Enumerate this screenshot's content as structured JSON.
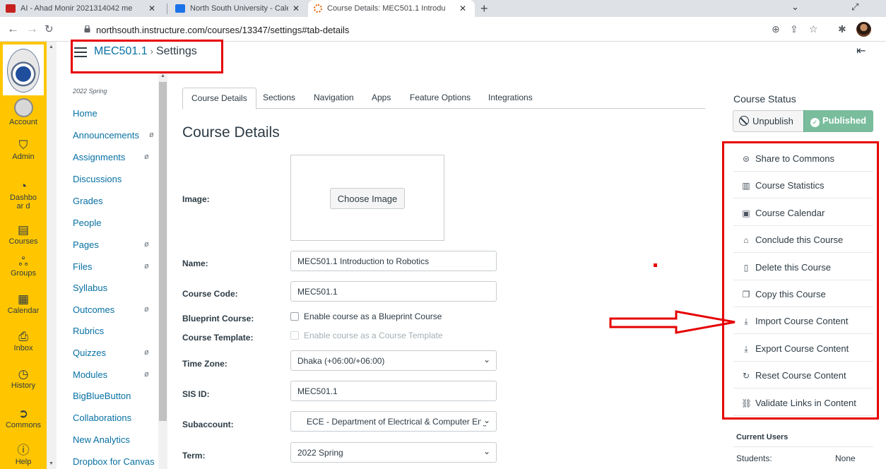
{
  "browser": {
    "tabs": [
      {
        "title": "AI - Ahad Monir 2021314042 me",
        "favicon_color": "#c5221f"
      },
      {
        "title": "North South University - Calenda",
        "favicon_color": "#1a73e8"
      },
      {
        "title": "Course Details: MEC501.1 Introdu",
        "favicon_color": "#e66000",
        "active": true
      }
    ],
    "url": "northsouth.instructure.com/courses/13347/settings#tab-details"
  },
  "global_nav": {
    "items": [
      {
        "label": "Account",
        "icon": "account-avatar-icon"
      },
      {
        "label": "Admin",
        "icon": "admin-shield-icon"
      },
      {
        "label": "Dashboar d",
        "icon": "dashboard-icon"
      },
      {
        "label": "Courses",
        "icon": "courses-book-icon"
      },
      {
        "label": "Groups",
        "icon": "groups-icon"
      },
      {
        "label": "Calendar",
        "icon": "calendar-icon"
      },
      {
        "label": "Inbox",
        "icon": "inbox-icon"
      },
      {
        "label": "History",
        "icon": "history-clock-icon"
      },
      {
        "label": "Commons",
        "icon": "commons-icon"
      },
      {
        "label": "Help",
        "icon": "help-icon"
      }
    ],
    "bg_color": "#ffc600"
  },
  "header": {
    "course": "MEC501.1",
    "current": "Settings"
  },
  "course_nav": {
    "term": "2022 Spring",
    "items": [
      {
        "label": "Home",
        "hidden": false
      },
      {
        "label": "Announcements",
        "hidden": true
      },
      {
        "label": "Assignments",
        "hidden": true
      },
      {
        "label": "Discussions",
        "hidden": false
      },
      {
        "label": "Grades",
        "hidden": false
      },
      {
        "label": "People",
        "hidden": false
      },
      {
        "label": "Pages",
        "hidden": true
      },
      {
        "label": "Files",
        "hidden": true
      },
      {
        "label": "Syllabus",
        "hidden": false
      },
      {
        "label": "Outcomes",
        "hidden": true
      },
      {
        "label": "Rubrics",
        "hidden": false
      },
      {
        "label": "Quizzes",
        "hidden": true
      },
      {
        "label": "Modules",
        "hidden": true
      },
      {
        "label": "BigBlueButton",
        "hidden": false
      },
      {
        "label": "Collaborations",
        "hidden": false
      },
      {
        "label": "New Analytics",
        "hidden": false
      },
      {
        "label": "Dropbox for Canvas",
        "hidden": false
      }
    ]
  },
  "settings_tabs": [
    "Course Details",
    "Sections",
    "Navigation",
    "Apps",
    "Feature Options",
    "Integrations"
  ],
  "main": {
    "title": "Course Details",
    "image_label": "Image:",
    "choose_image": "Choose Image",
    "name_label": "Name:",
    "name_value": "MEC501.1 Introduction to Robotics",
    "code_label": "Course Code:",
    "code_value": "MEC501.1",
    "blueprint_label": "Blueprint Course:",
    "blueprint_text": "Enable course as a Blueprint Course",
    "template_label": "Course Template:",
    "template_text": "Enable course as a Course Template",
    "timezone_label": "Time Zone:",
    "timezone_value": "Dhaka (+06:00/+06:00)",
    "sis_label": "SIS ID:",
    "sis_value": "MEC501.1",
    "subaccount_label": "Subaccount:",
    "subaccount_value": "ECE - Department of Electrical & Computer Engi",
    "term_label": "Term:",
    "term_value": "2022 Spring"
  },
  "sidebar": {
    "status_title": "Course Status",
    "unpublish": "Unpublish",
    "published": "Published",
    "actions": [
      {
        "label": "Share to Commons",
        "icon": "share-icon"
      },
      {
        "label": "Course Statistics",
        "icon": "statistics-icon"
      },
      {
        "label": "Course Calendar",
        "icon": "calendar-icon"
      },
      {
        "label": "Conclude this Course",
        "icon": "lock-icon"
      },
      {
        "label": "Delete this Course",
        "icon": "trash-icon"
      },
      {
        "label": "Copy this Course",
        "icon": "copy-icon"
      },
      {
        "label": "Import Course Content",
        "icon": "import-icon"
      },
      {
        "label": "Export Course Content",
        "icon": "export-icon"
      },
      {
        "label": "Reset Course Content",
        "icon": "reset-icon"
      },
      {
        "label": "Validate Links in Content",
        "icon": "link-icon"
      }
    ],
    "current_users_title": "Current Users",
    "students_label": "Students:",
    "students_value": "None"
  },
  "annotation_color": "#e60000"
}
